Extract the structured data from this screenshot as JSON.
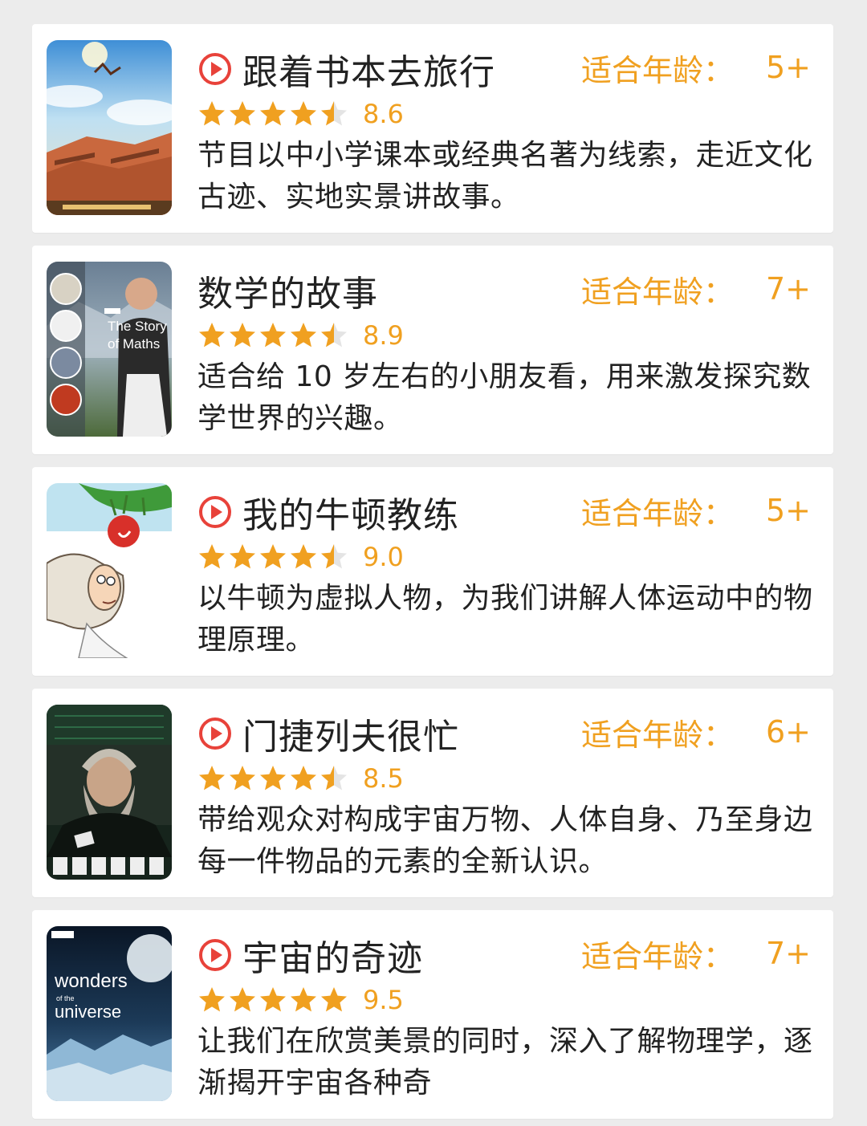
{
  "age_label": "适合年龄：",
  "colors": {
    "accent": "#f0a020",
    "play": "#e8423a",
    "text": "#222222",
    "background": "#ececec",
    "card": "#ffffff"
  },
  "items": [
    {
      "title": "跟着书本去旅行",
      "has_play_icon": true,
      "age": "5+",
      "rating": 8.6,
      "stars": 4.5,
      "rating_text": "8.6",
      "description": "节目以中小学课本或经典名著为线索，走近文化古迹、实地实景讲故事。",
      "poster": {
        "kind": "travel",
        "text": ""
      }
    },
    {
      "title": "数学的故事",
      "has_play_icon": false,
      "age": "7+",
      "rating": 8.9,
      "stars": 4.5,
      "rating_text": "8.9",
      "description": "适合给 10 岁左右的小朋友看，用来激发探究数学世界的兴趣。",
      "poster": {
        "kind": "maths",
        "text": "The Story of Maths"
      }
    },
    {
      "title": "我的牛顿教练",
      "has_play_icon": true,
      "age": "5+",
      "rating": 9.0,
      "stars": 4.5,
      "rating_text": "9.0",
      "description": "以牛顿为虚拟人物，为我们讲解人体运动中的物理原理。",
      "poster": {
        "kind": "newton",
        "text": ""
      }
    },
    {
      "title": "门捷列夫很忙",
      "has_play_icon": true,
      "age": "6+",
      "rating": 8.5,
      "stars": 4.5,
      "rating_text": "8.5",
      "description": "带给观众对构成宇宙万物、人体自身、乃至身边每一件物品的元素的全新认识。",
      "poster": {
        "kind": "mendeleev",
        "text": ""
      }
    },
    {
      "title": "宇宙的奇迹",
      "has_play_icon": true,
      "age": "7+",
      "rating": 9.5,
      "stars": 5,
      "rating_text": "9.5",
      "description": "让我们在欣赏美景的同时，深入了解物理学，逐渐揭开宇宙各种奇",
      "poster": {
        "kind": "wonders",
        "text": "wonders of the universe"
      }
    }
  ]
}
